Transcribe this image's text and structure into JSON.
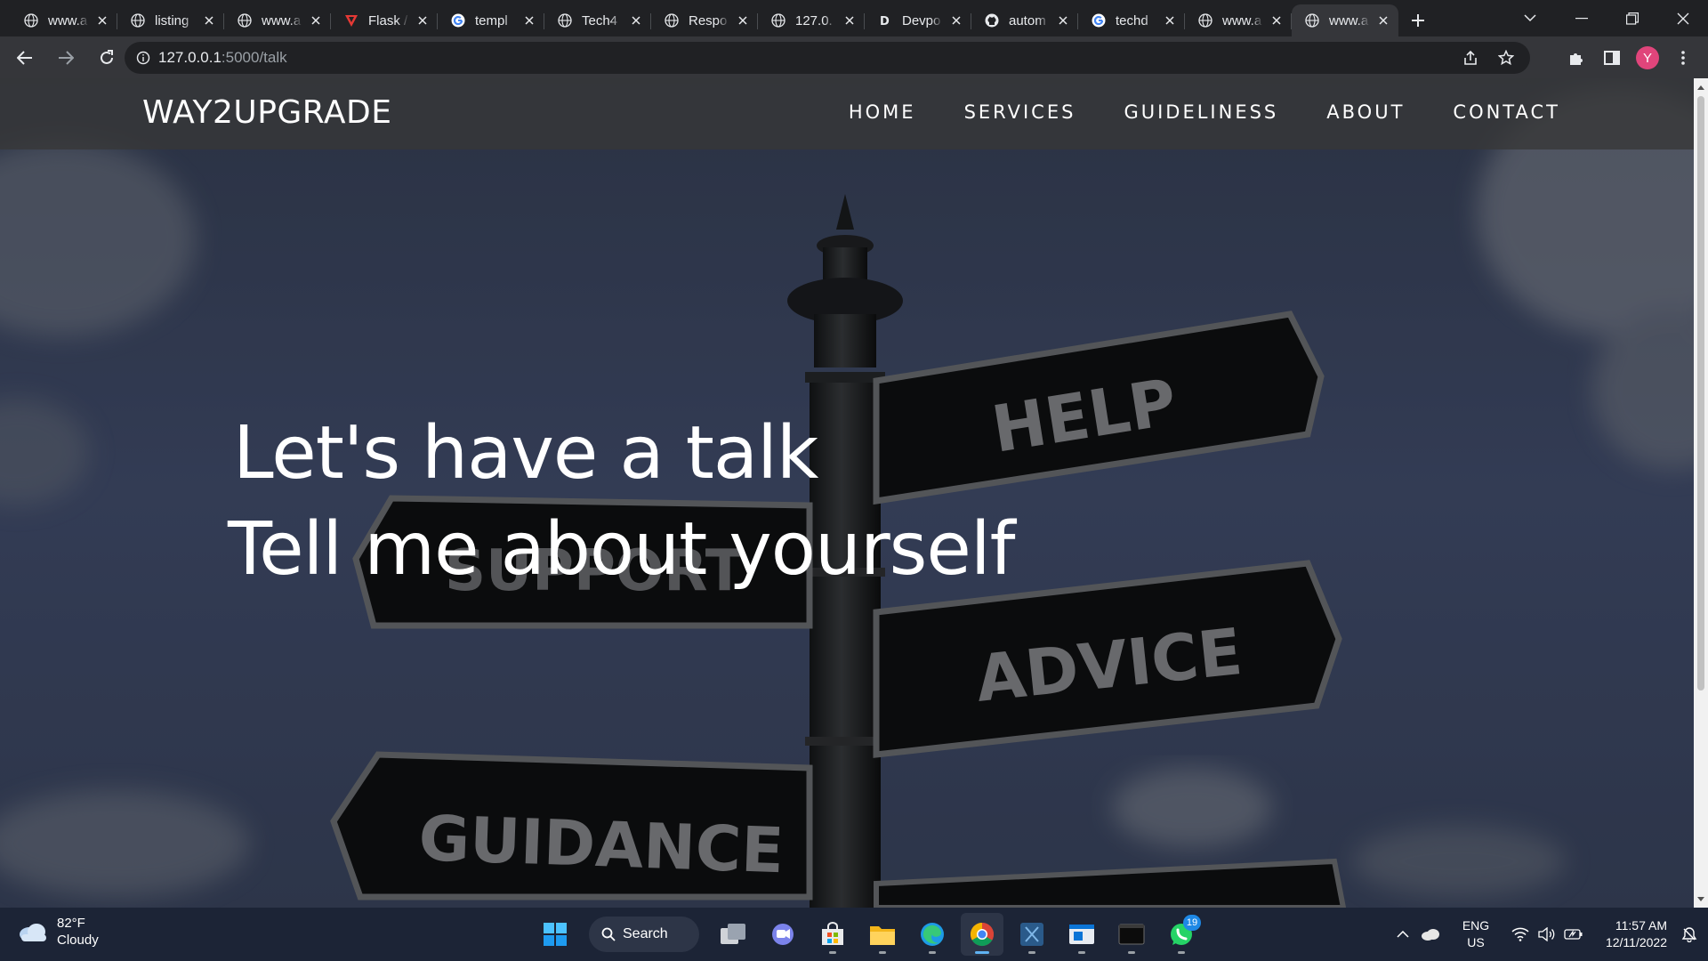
{
  "browser": {
    "tabs": [
      {
        "label": "www.a",
        "icon": "globe-icon"
      },
      {
        "label": "listing",
        "icon": "globe-icon"
      },
      {
        "label": "www.a",
        "icon": "globe-icon"
      },
      {
        "label": "Flask /",
        "icon": "flask-logo-icon"
      },
      {
        "label": "templ",
        "icon": "google-icon"
      },
      {
        "label": "Tech4",
        "icon": "globe-icon"
      },
      {
        "label": "Respo",
        "icon": "globe-icon"
      },
      {
        "label": "127.0.",
        "icon": "globe-icon"
      },
      {
        "label": "Devpo",
        "icon": "devpost-icon"
      },
      {
        "label": "autom",
        "icon": "github-icon"
      },
      {
        "label": "techd",
        "icon": "google-icon"
      },
      {
        "label": "www.a",
        "icon": "globe-icon"
      },
      {
        "label": "www.a",
        "icon": "globe-icon",
        "active": true
      }
    ],
    "url_host": "127.0.0.1",
    "url_path": ":5000/talk",
    "profile_initial": "Y",
    "profile_color": "#e0457b"
  },
  "site": {
    "brand": "WAY2UPGRADE",
    "nav": [
      "HOME",
      "SERVICES",
      "GUIDELINESS",
      "ABOUT",
      "CONTACT"
    ],
    "hero_line1": "Let's have a talk",
    "hero_line2": "Tell me about yourself",
    "signs": {
      "help": "HELP",
      "support": "SUPPORT",
      "advice": "ADVICE",
      "guidance": "GUIDANCE"
    }
  },
  "taskbar": {
    "weather_temp": "82°F",
    "weather_desc": "Cloudy",
    "search_label": "Search",
    "whatsapp_badge": "19",
    "lang_top": "ENG",
    "lang_bottom": "US",
    "time": "11:57 AM",
    "date": "12/11/2022"
  }
}
